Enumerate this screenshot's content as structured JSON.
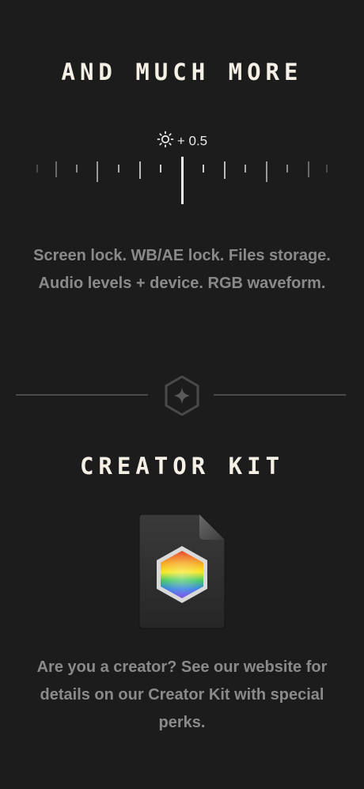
{
  "section_more": {
    "title": "AND MUCH MORE",
    "exposure_value": "+ 0.5",
    "description": "Screen lock. WB/AE lock. Files storage. Audio levels + device. RGB waveform."
  },
  "divider": {
    "icon": "sparkle-hexagon-icon"
  },
  "section_kit": {
    "title": "CREATOR KIT",
    "icon": "creator-kit-file-icon",
    "description": "Are you a creator? See our website for details on our Creator Kit with special perks."
  },
  "colors": {
    "background": "#1c1c1c",
    "title": "#f5f0e6",
    "body_text": "#8a8a8a",
    "divider": "#4a4a4a"
  }
}
